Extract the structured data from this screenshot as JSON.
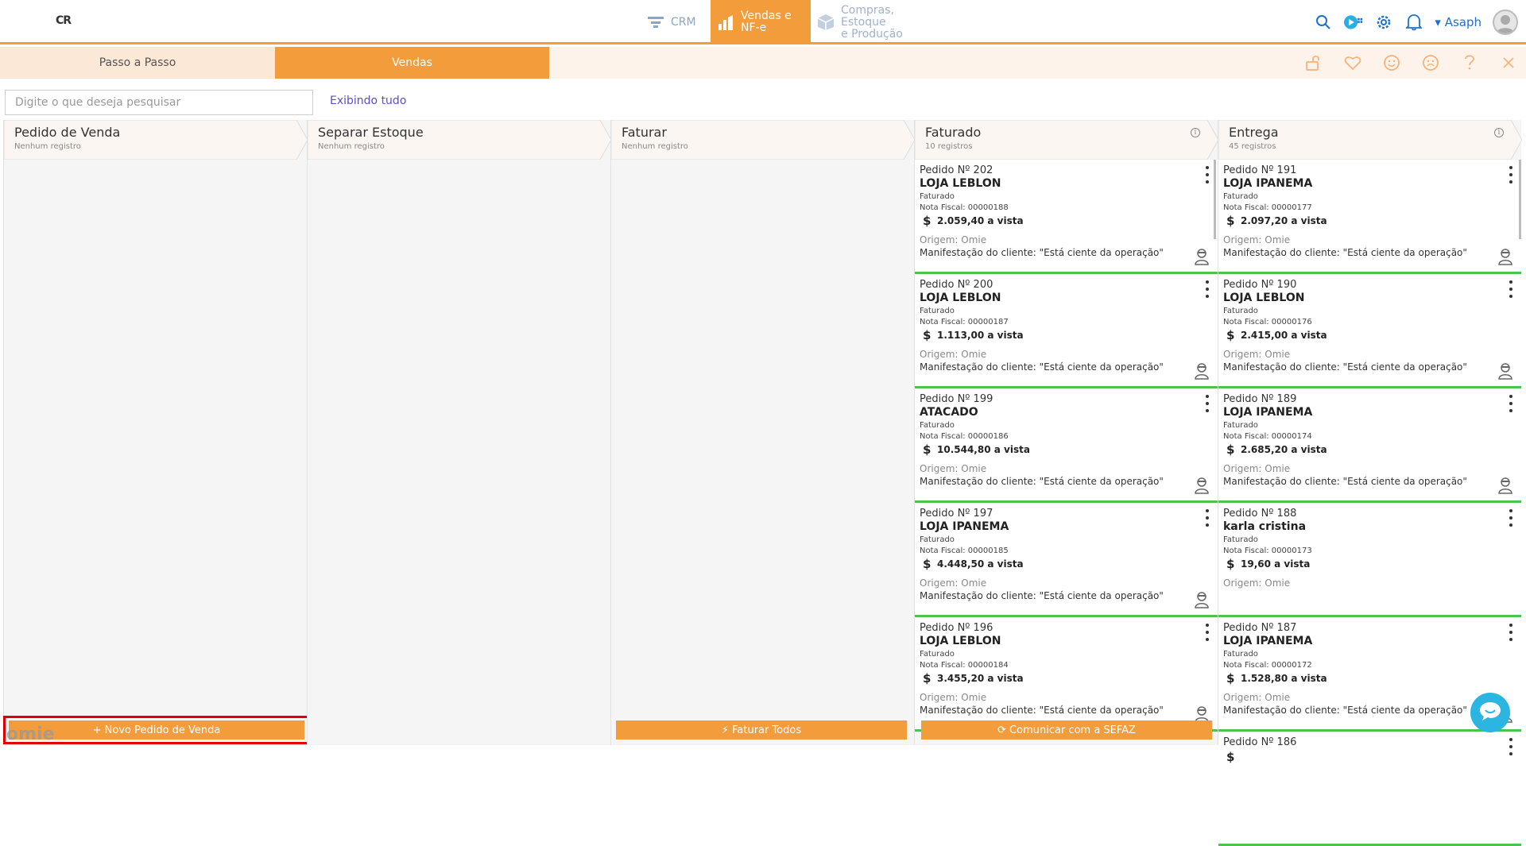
{
  "topbar": {
    "logo_text": "CR",
    "modules": [
      {
        "label": "CRM",
        "icon": "funnel-icon"
      },
      {
        "label_line1": "Vendas e",
        "label_line2": "NF-e",
        "icon": "bar-chart-icon",
        "active": true
      },
      {
        "label_line1": "Compras, Estoque",
        "label_line2": "e Produção",
        "icon": "box-icon"
      }
    ],
    "user_name": "Asaph",
    "accent_color": "#f39c3b"
  },
  "tabs": [
    {
      "label": "Passo a Passo"
    },
    {
      "label": "Vendas",
      "active": true
    }
  ],
  "search": {
    "placeholder": "Digite o que deseja pesquisar",
    "show_all_label": "Exibindo tudo"
  },
  "columns": [
    {
      "title": "Pedido de Venda",
      "subtitle": "Nenhum registro",
      "button": "+ Novo Pedido de Venda",
      "cards": []
    },
    {
      "title": "Separar Estoque",
      "subtitle": "Nenhum registro",
      "cards": []
    },
    {
      "title": "Faturar",
      "subtitle": "Nenhum registro",
      "button": "⚡ Faturar Todos",
      "cards": []
    },
    {
      "title": "Faturado",
      "subtitle": "10 registros",
      "button": "⟳ Comunicar com a SEFAZ",
      "cards": [
        {
          "num": "Pedido Nº 202",
          "client": "LOJA LEBLON",
          "status": "Faturado",
          "nf": "Nota Fiscal: 00000188",
          "value": "2.059,40 a vista",
          "origin": "Origem: Omie",
          "manifest": "Manifestação do cliente: \"Está ciente da operação\""
        },
        {
          "num": "Pedido Nº 200",
          "client": "LOJA LEBLON",
          "status": "Faturado",
          "nf": "Nota Fiscal: 00000187",
          "value": "1.113,00 a vista",
          "origin": "Origem: Omie",
          "manifest": "Manifestação do cliente: \"Está ciente da operação\""
        },
        {
          "num": "Pedido Nº 199",
          "client": "ATACADO",
          "status": "Faturado",
          "nf": "Nota Fiscal: 00000186",
          "value": "10.544,80 a vista",
          "origin": "Origem: Omie",
          "manifest": "Manifestação do cliente: \"Está ciente da operação\""
        },
        {
          "num": "Pedido Nº 197",
          "client": "LOJA IPANEMA",
          "status": "Faturado",
          "nf": "Nota Fiscal: 00000185",
          "value": "4.448,50 a vista",
          "origin": "Origem: Omie",
          "manifest": "Manifestação do cliente: \"Está ciente da operação\""
        },
        {
          "num": "Pedido Nº 196",
          "client": "LOJA LEBLON",
          "status": "Faturado",
          "nf": "Nota Fiscal: 00000184",
          "value": "3.455,20 a vista",
          "origin": "Origem: Omie",
          "manifest": "Manifestação do cliente: \"Está ciente da operação\""
        }
      ]
    },
    {
      "title": "Entrega",
      "subtitle": "45 registros",
      "cards": [
        {
          "num": "Pedido Nº 191",
          "client": "LOJA IPANEMA",
          "status": "Faturado",
          "nf": "Nota Fiscal: 00000177",
          "value": "2.097,20 a vista",
          "origin": "Origem: Omie",
          "manifest": "Manifestação do cliente: \"Está ciente da operação\""
        },
        {
          "num": "Pedido Nº 190",
          "client": "LOJA LEBLON",
          "status": "Faturado",
          "nf": "Nota Fiscal: 00000176",
          "value": "2.415,00 a vista",
          "origin": "Origem: Omie",
          "manifest": "Manifestação do cliente: \"Está ciente da operação\""
        },
        {
          "num": "Pedido Nº 189",
          "client": "LOJA IPANEMA",
          "status": "Faturado",
          "nf": "Nota Fiscal: 00000174",
          "value": "2.685,20 a vista",
          "origin": "Origem: Omie",
          "manifest": "Manifestação do cliente: \"Está ciente da operação\""
        },
        {
          "num": "Pedido Nº 188",
          "client": "karla cristina",
          "status": "Faturado",
          "nf": "Nota Fiscal: 00000173",
          "value": "19,60 a vista",
          "origin": "Origem: Omie",
          "manifest": ""
        },
        {
          "num": "Pedido Nº 187",
          "client": "LOJA IPANEMA",
          "status": "Faturado",
          "nf": "Nota Fiscal: 00000172",
          "value": "1.528,80 a vista",
          "origin": "Origem: Omie",
          "manifest": "Manifestação do cliente: \"Está ciente da operação\""
        },
        {
          "num": "Pedido Nº 186",
          "client": "",
          "status": "",
          "nf": "",
          "value": "",
          "origin": "",
          "manifest": ""
        }
      ]
    }
  ],
  "footer": {
    "brand": "omie"
  }
}
